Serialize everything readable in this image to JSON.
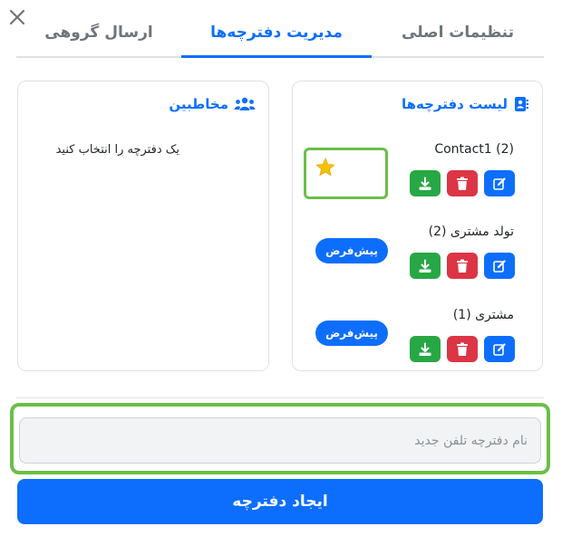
{
  "tabs": [
    {
      "label": "تنظیمات اصلی"
    },
    {
      "label": "مدیریت دفترچه‌ها"
    },
    {
      "label": "ارسال گروهی"
    }
  ],
  "phonebook_list": {
    "title": "لیست دفترچه‌ها",
    "icon": "address-book-icon",
    "items": [
      {
        "name": "Contact1 (2)",
        "is_default": true
      },
      {
        "name": "تولد مشتری (2)",
        "is_default": false,
        "default_label": "پیش‌فرض"
      },
      {
        "name": "مشتری (1)",
        "is_default": false,
        "default_label": "پیش‌فرض"
      }
    ]
  },
  "contacts": {
    "title": "مخاطبین",
    "icon": "users-icon",
    "empty_text": "یک دفترچه را انتخاب کنید"
  },
  "new_phonebook": {
    "placeholder": "نام دفترچه تلفن جدید",
    "value": ""
  },
  "create_button": {
    "label": "ایجاد دفترچه"
  },
  "colors": {
    "primary": "#0d6efd",
    "danger": "#dc3545",
    "success": "#28a745",
    "highlight": "#6abf47",
    "star": "#f6c000"
  }
}
